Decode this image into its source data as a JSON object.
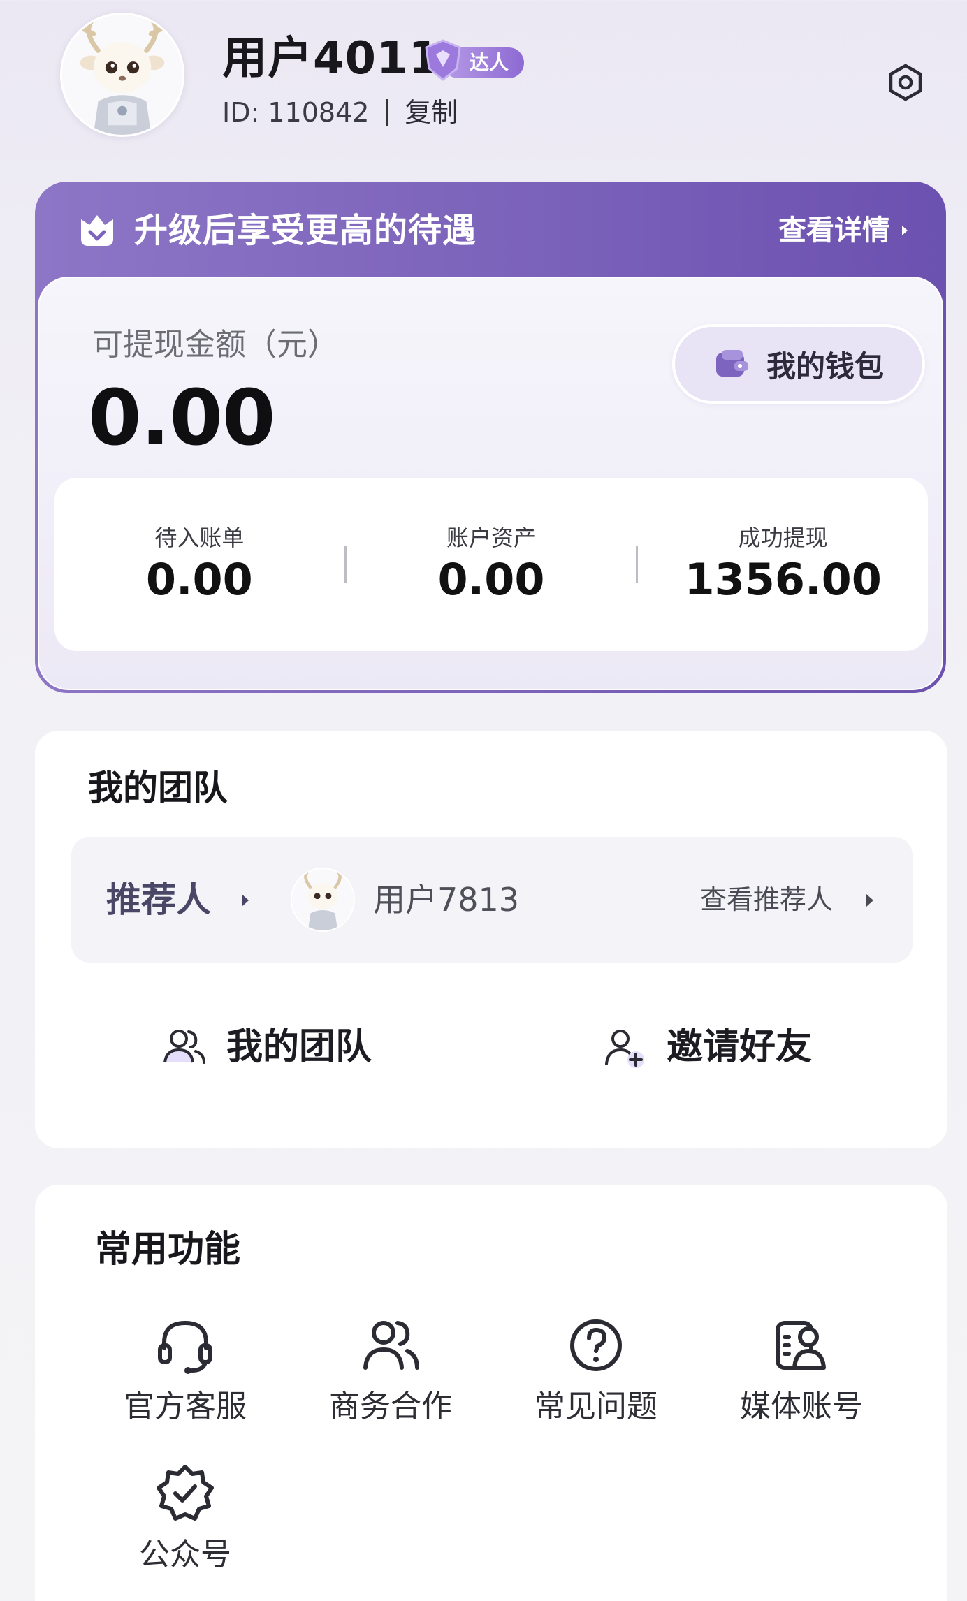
{
  "profile": {
    "username": "用户4011",
    "badge_label": "达人",
    "id_text": "ID: 110842",
    "copy_label": "复制"
  },
  "upgrade": {
    "title": "升级后享受更高的待遇",
    "details_label": "查看详情",
    "balance_label": "可提现金额（元）",
    "balance_amount": "0.00",
    "wallet_label": "我的钱包",
    "stats": [
      {
        "label": "待入账单",
        "value": "0.00"
      },
      {
        "label": "账户资产",
        "value": "0.00"
      },
      {
        "label": "成功提现",
        "value": "1356.00"
      }
    ]
  },
  "team": {
    "title": "我的团队",
    "referrer_label": "推荐人",
    "referrer_name": "用户7813",
    "view_referrer_label": "查看推荐人",
    "actions": [
      {
        "label": "我的团队",
        "icon": "users-icon"
      },
      {
        "label": "邀请好友",
        "icon": "add-user-icon"
      }
    ]
  },
  "functions": {
    "title": "常用功能",
    "items": [
      {
        "label": "官方客服",
        "icon": "headset-icon"
      },
      {
        "label": "商务合作",
        "icon": "users-icon"
      },
      {
        "label": "常见问题",
        "icon": "question-icon"
      },
      {
        "label": "媒体账号",
        "icon": "media-account-icon"
      },
      {
        "label": "公众号",
        "icon": "verified-badge-icon"
      }
    ]
  },
  "colors": {
    "accent_purple": "#6c51b0",
    "accent_purple_light": "#8d76c6",
    "badge_gradient_start": "#b69ae6",
    "badge_gradient_end": "#8d6ad3",
    "page_background": "#f2f1f6"
  }
}
